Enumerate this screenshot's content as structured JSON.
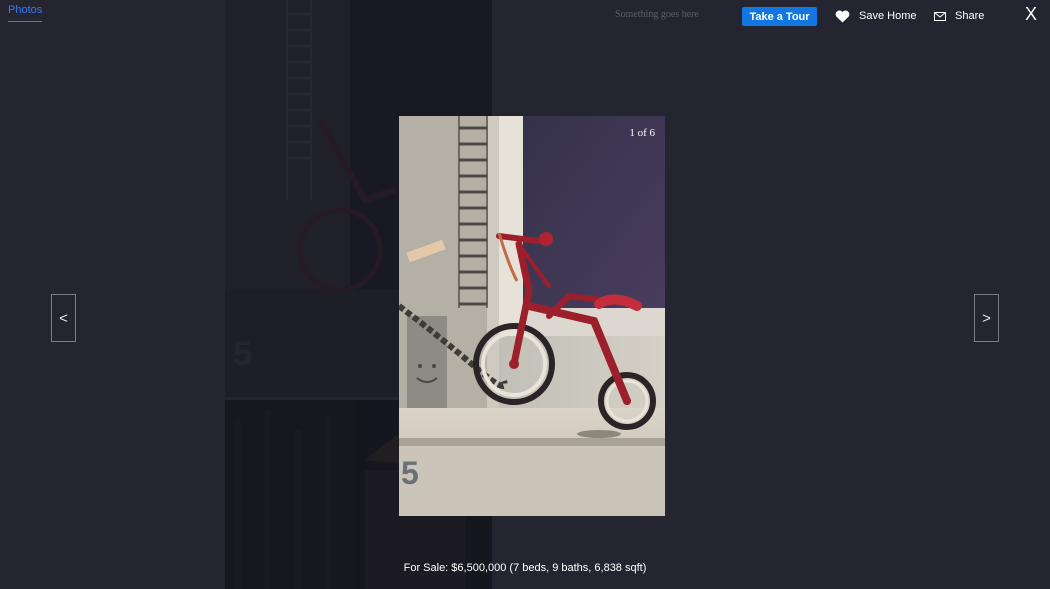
{
  "header": {
    "tab_photos": "Photos",
    "tagline": "Something goes here",
    "tour_button": "Take a Tour",
    "save_label": "Save Home",
    "share_label": "Share",
    "close_label": "X"
  },
  "gallery": {
    "counter": "1 of 6",
    "prev_label": "<",
    "next_label": ">",
    "caption": "For Sale: $6,500,000 (7 beds, 9 baths, 6,838 sqft)",
    "current_index": 1,
    "total": 6
  },
  "icons": {
    "save": "heart-icon",
    "share": "envelope-icon",
    "close": "close-icon"
  },
  "colors": {
    "background": "#252532",
    "accent": "#1277e1",
    "tab_active": "#2f7df6",
    "bike_red": "#9c1f2c"
  }
}
